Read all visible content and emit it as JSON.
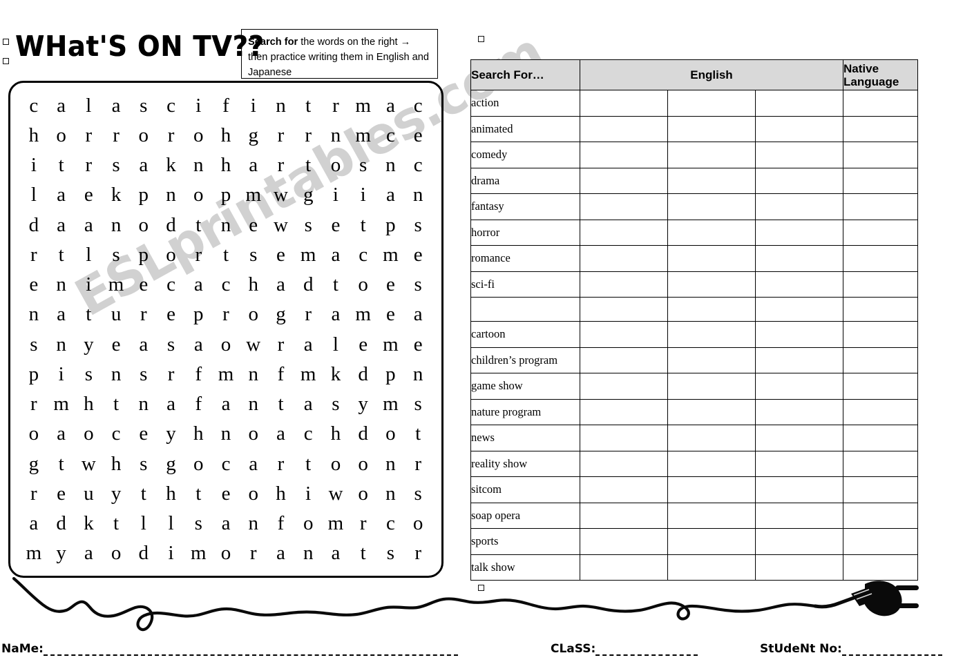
{
  "header": {
    "title": "WHat'S ON TV??",
    "instruction_bold": "Search for",
    "instruction_rest": " the words on the right → then practice writing them in English and Japanese"
  },
  "grid": {
    "rows": [
      [
        "c",
        "a",
        "l",
        "a",
        "s",
        "c",
        "i",
        "f",
        "i",
        "n",
        "t",
        "r",
        "m",
        "a",
        "c"
      ],
      [
        "h",
        "o",
        "r",
        "r",
        "o",
        "r",
        "o",
        "h",
        "g",
        "r",
        "r",
        "n",
        "m",
        "c",
        "e"
      ],
      [
        "i",
        "t",
        "r",
        "s",
        "a",
        "k",
        "n",
        "h",
        "a",
        "r",
        "t",
        "o",
        "s",
        "n",
        "c"
      ],
      [
        "l",
        "a",
        "e",
        "k",
        "p",
        "n",
        "o",
        "p",
        "m",
        "w",
        "g",
        "i",
        "i",
        "a",
        "n"
      ],
      [
        "d",
        "a",
        "a",
        "n",
        "o",
        "d",
        "t",
        "n",
        "e",
        "w",
        "s",
        "e",
        "t",
        "p",
        "s"
      ],
      [
        "r",
        "t",
        "l",
        "s",
        "p",
        "o",
        "r",
        "t",
        "s",
        "e",
        "m",
        "a",
        "c",
        "m",
        "e"
      ],
      [
        "e",
        "n",
        "i",
        "m",
        "e",
        "c",
        "a",
        "c",
        "h",
        "a",
        "d",
        "t",
        "o",
        "e",
        "s"
      ],
      [
        "n",
        "a",
        "t",
        "u",
        "r",
        "e",
        "p",
        "r",
        "o",
        "g",
        "r",
        "a",
        "m",
        "e",
        "a"
      ],
      [
        "s",
        "n",
        "y",
        "e",
        "a",
        "s",
        "a",
        "o",
        "w",
        "r",
        "a",
        "l",
        "e",
        "m",
        "e"
      ],
      [
        "p",
        "i",
        "s",
        "n",
        "s",
        "r",
        "f",
        "m",
        "n",
        "f",
        "m",
        "k",
        "d",
        "p",
        "n"
      ],
      [
        "r",
        "m",
        "h",
        "t",
        "n",
        "a",
        "f",
        "a",
        "n",
        "t",
        "a",
        "s",
        "y",
        "m",
        "s"
      ],
      [
        "o",
        "a",
        "o",
        "c",
        "e",
        "y",
        "h",
        "n",
        "o",
        "a",
        "c",
        "h",
        "d",
        "o",
        "t"
      ],
      [
        "g",
        "t",
        "w",
        "h",
        "s",
        "g",
        "o",
        "c",
        "a",
        "r",
        "t",
        "o",
        "o",
        "n",
        "r"
      ],
      [
        "r",
        "e",
        "u",
        "y",
        "t",
        "h",
        "t",
        "e",
        "o",
        "h",
        "i",
        "w",
        "o",
        "n",
        "s"
      ],
      [
        "a",
        "d",
        "k",
        "t",
        "l",
        "l",
        "s",
        "a",
        "n",
        "f",
        "o",
        "m",
        "r",
        "c",
        "o"
      ],
      [
        "m",
        "y",
        "a",
        "o",
        "d",
        "i",
        "m",
        "o",
        "r",
        "a",
        "n",
        "a",
        "t",
        "s",
        "r"
      ]
    ]
  },
  "watermark": {
    "text": "ESLprintables.com"
  },
  "table": {
    "headers": {
      "search_for": "Search For…",
      "english": "English",
      "native_language": "Native Language"
    },
    "rows": [
      {
        "word": "action"
      },
      {
        "word": "animated"
      },
      {
        "word": "comedy"
      },
      {
        "word": "drama"
      },
      {
        "word": "fantasy"
      },
      {
        "word": "horror"
      },
      {
        "word": "romance"
      },
      {
        "word": "sci-fi"
      },
      {
        "word": ""
      },
      {
        "word": "cartoon"
      },
      {
        "word": "children’s program"
      },
      {
        "word": "game show"
      },
      {
        "word": "nature program"
      },
      {
        "word": "news"
      },
      {
        "word": "reality show"
      },
      {
        "word": "sitcom"
      },
      {
        "word": "soap opera"
      },
      {
        "word": "sports"
      },
      {
        "word": "talk show"
      }
    ]
  },
  "footer": {
    "name_label": "NaMe:",
    "class_label": "CLaSS:",
    "student_label": "StUdeNt No:"
  },
  "colors": {
    "header_fill": "#d9d9d9",
    "ink": "#000000",
    "watermark": "rgba(0,0,0,0.18)"
  }
}
